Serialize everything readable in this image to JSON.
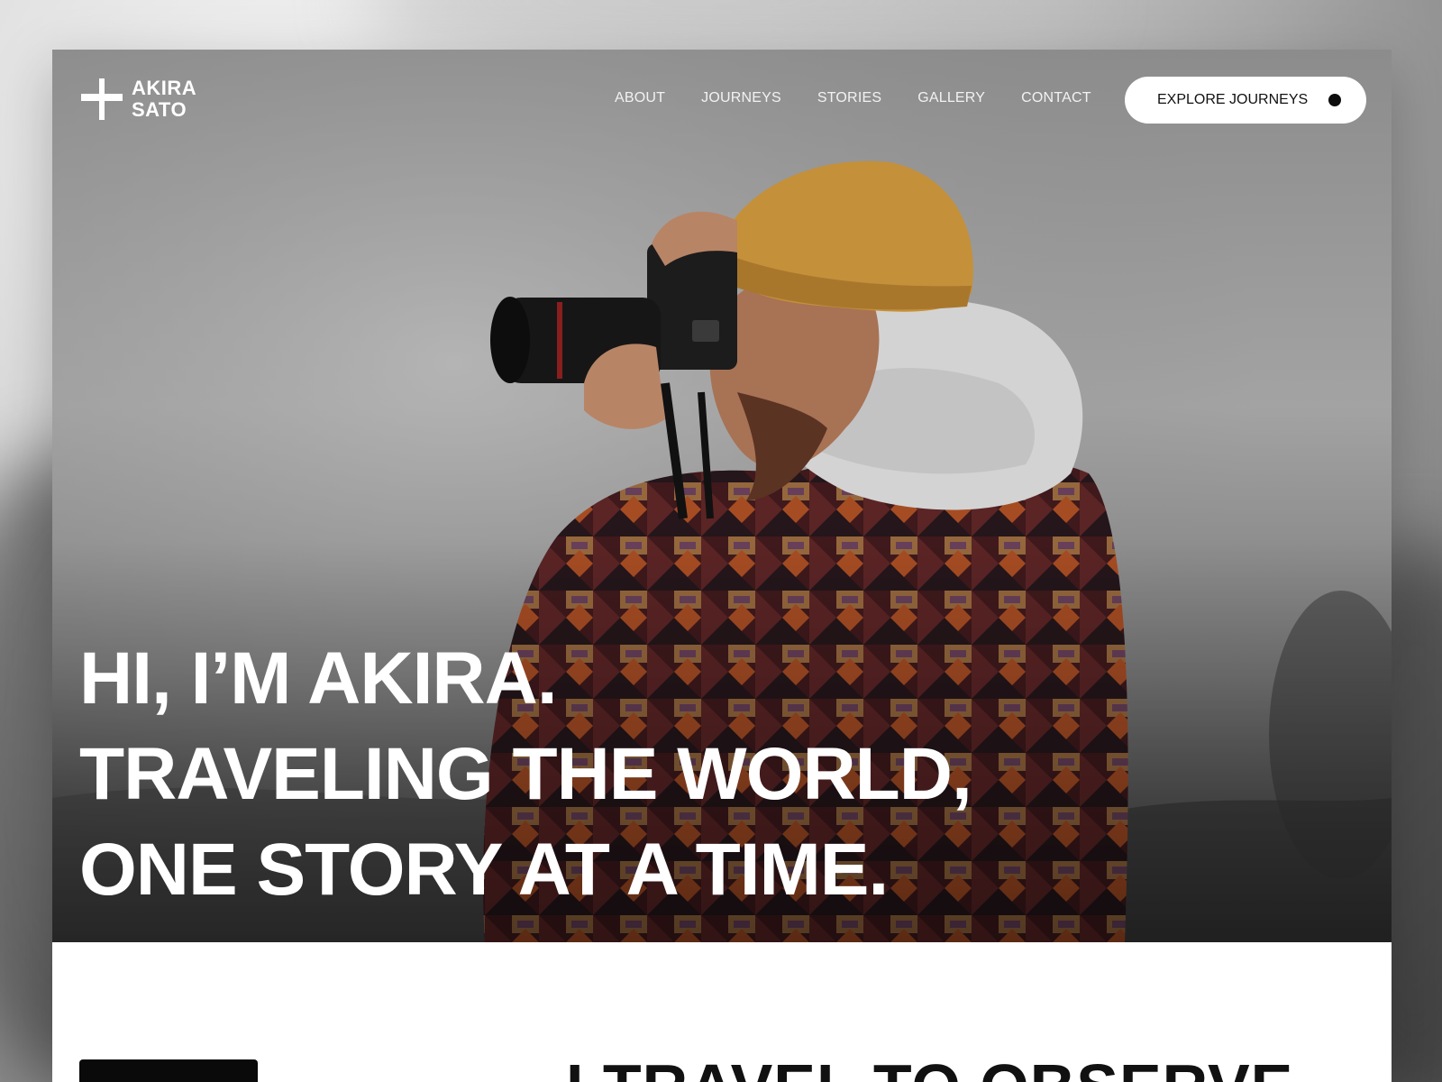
{
  "brand": {
    "name_line1": "AKIRA",
    "name_line2": "SATO"
  },
  "nav": {
    "items": [
      "ABOUT",
      "JOURNEYS",
      "STORIES",
      "GALLERY",
      "CONTACT"
    ]
  },
  "cta": {
    "label": "EXPLORE JOURNEYS"
  },
  "hero": {
    "headline_lines": [
      "HI, I’M AKIRA.",
      "TRAVELING THE WORLD,",
      "ONE STORY AT A TIME."
    ],
    "image_icon": "photographer-hero-photo"
  },
  "next_section": {
    "heading": "I TRAVEL TO OBSERVE"
  },
  "colors": {
    "text_light": "#ffffff",
    "button_bg": "#ffffff",
    "text_dark": "#111111",
    "hat": "#c4903a",
    "hood": "#d5d5d5"
  }
}
